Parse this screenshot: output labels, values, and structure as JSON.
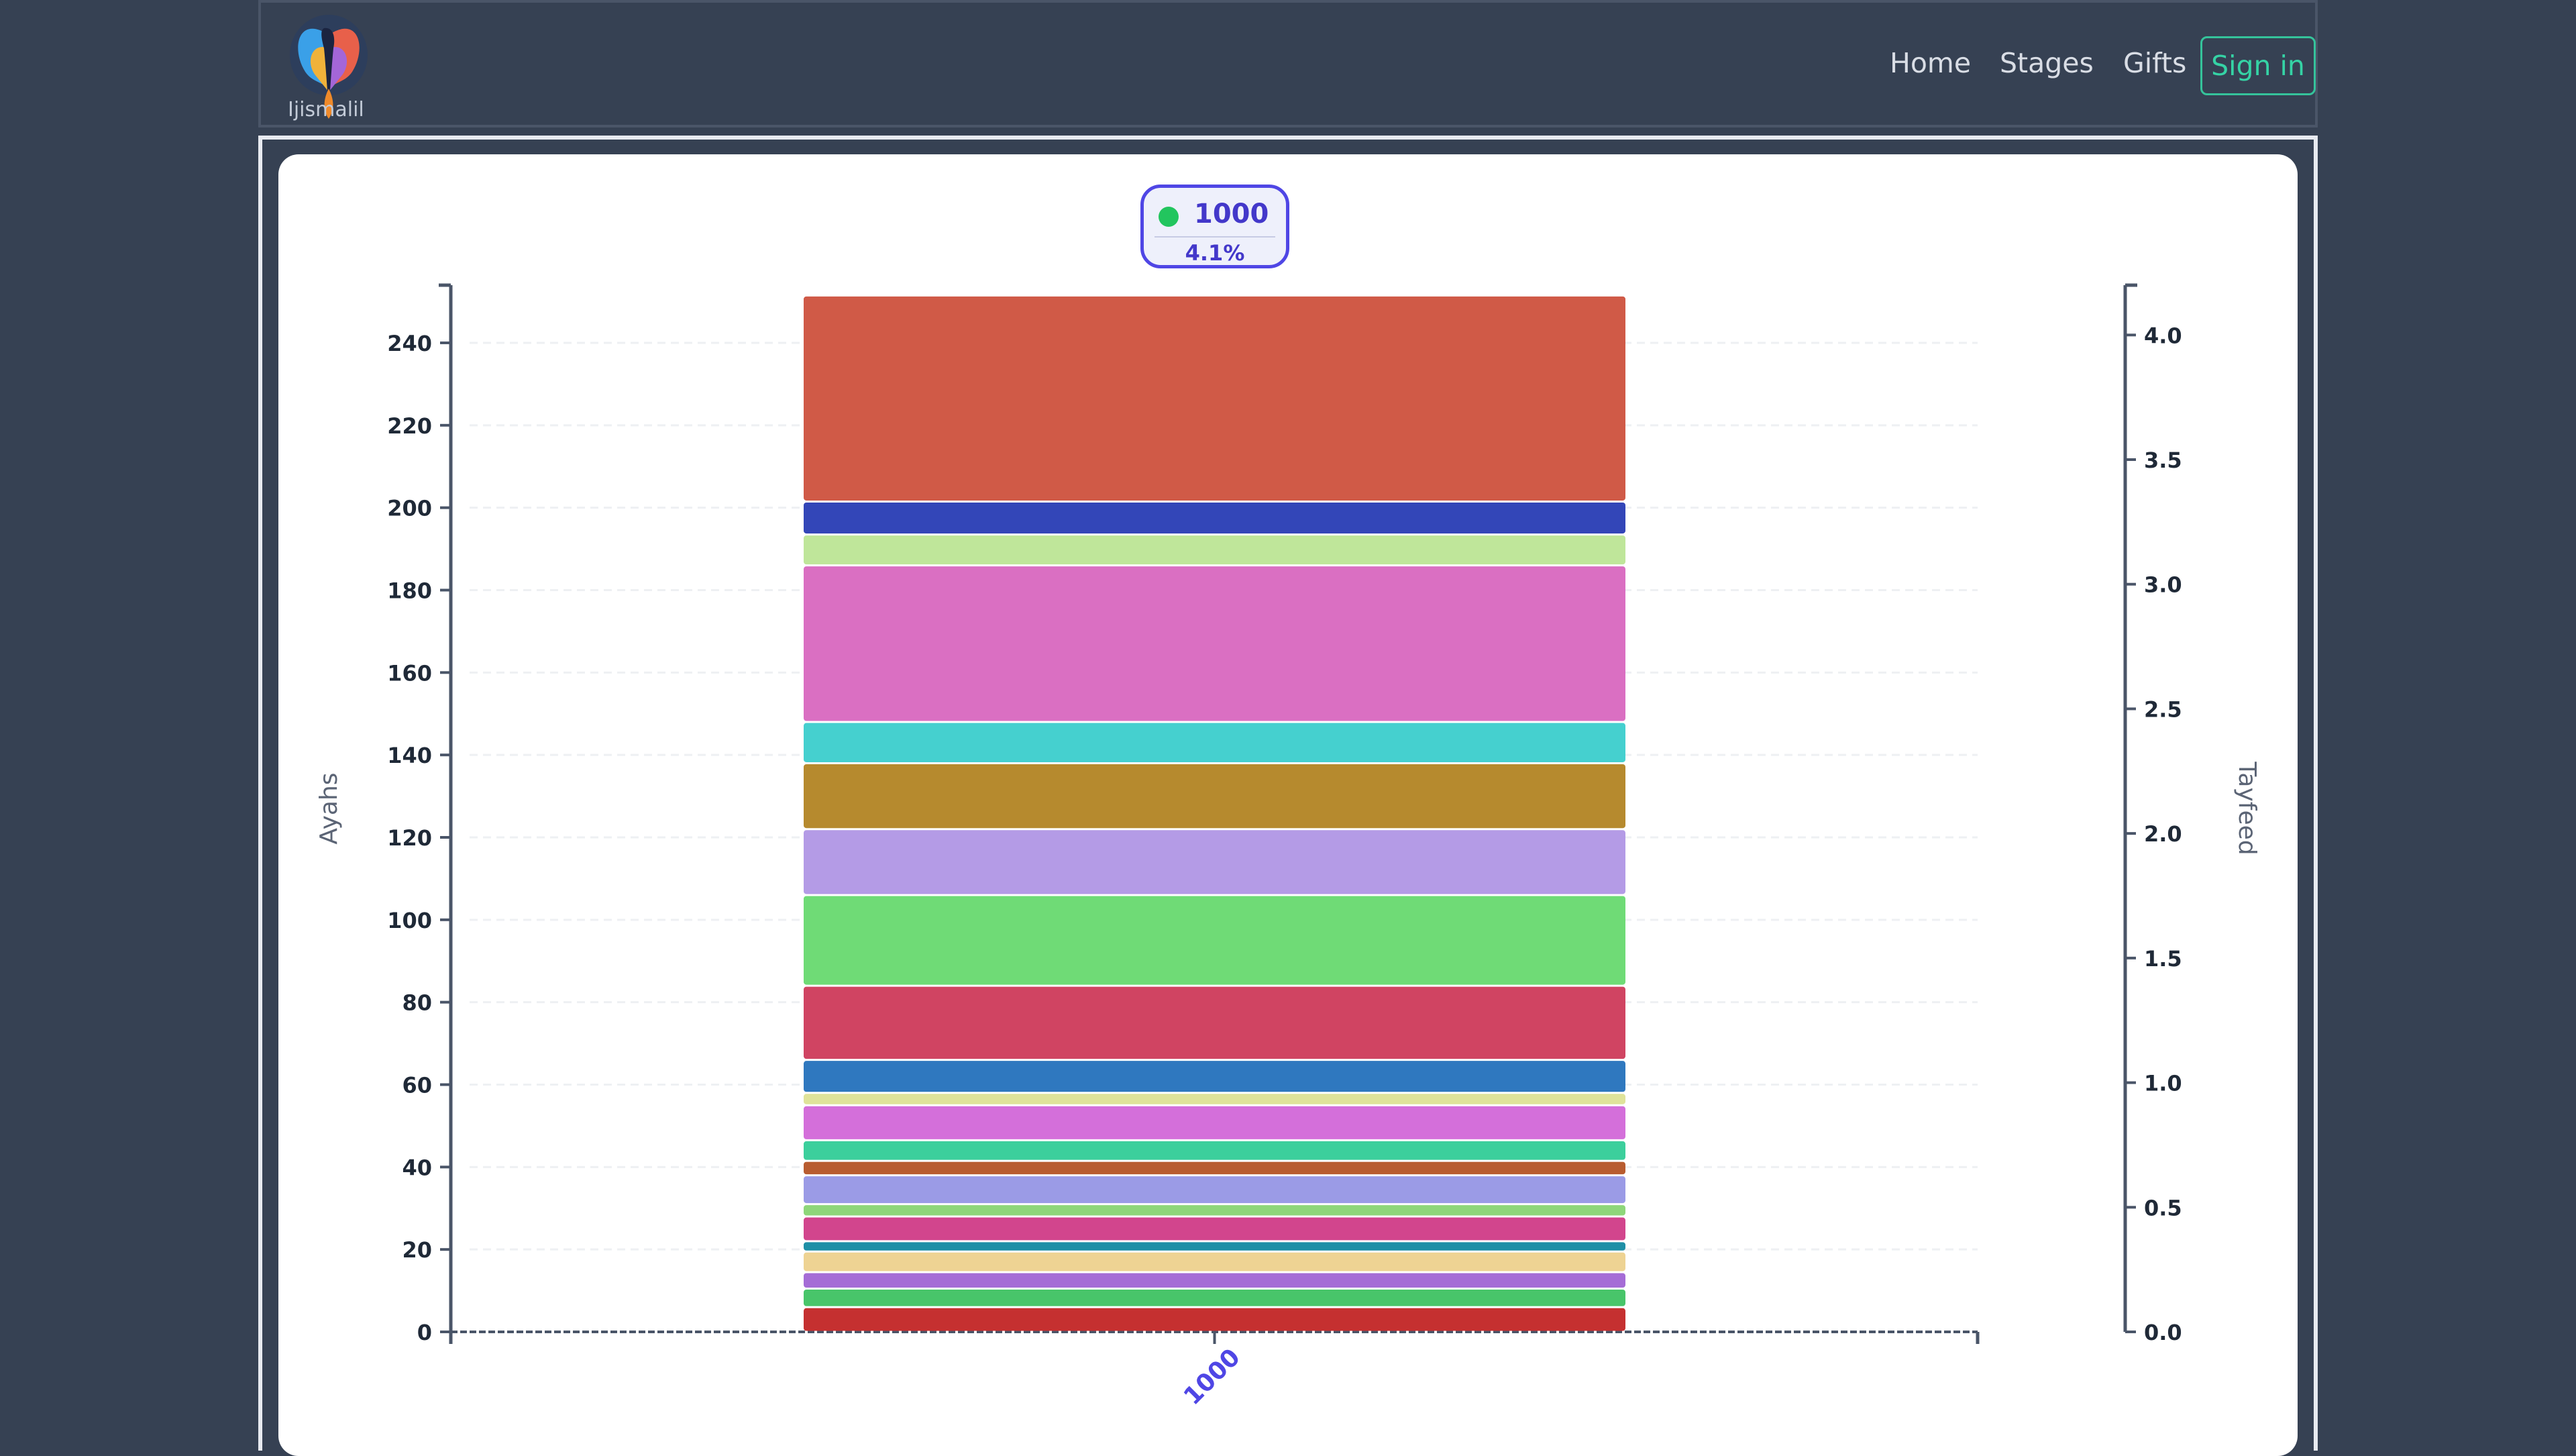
{
  "brand": {
    "logo_text": "Ijismalil"
  },
  "nav": {
    "home": "Home",
    "stages": "Stages",
    "gifts": "Gifts",
    "signin": "Sign in"
  },
  "tooltip": {
    "label": "1000",
    "value": "4.1%",
    "dot_color": "#22c55e"
  },
  "colors": {
    "accent": "#4f46e5",
    "signin": "#35c39b",
    "background": "#364153"
  },
  "chart_data": {
    "type": "bar",
    "stacked": true,
    "categories": [
      "1000"
    ],
    "xlabel": "",
    "ylabel": "Ayahs",
    "y2label": "Tayfeed",
    "ylim": [
      0,
      254
    ],
    "y2lim": [
      0,
      4.2
    ],
    "yticks": [
      0,
      20,
      40,
      60,
      80,
      100,
      120,
      140,
      160,
      180,
      200,
      220,
      240
    ],
    "y2ticks": [
      "0.0",
      "0.5",
      "1.0",
      "1.5",
      "2.0",
      "2.5",
      "3.0",
      "3.5",
      "4.0"
    ],
    "grid": true,
    "segments": [
      {
        "value": 6,
        "color": "#c53030"
      },
      {
        "value": 4.5,
        "color": "#48c56a"
      },
      {
        "value": 4,
        "color": "#a56cd6"
      },
      {
        "value": 5,
        "color": "#eed393"
      },
      {
        "value": 2.5,
        "color": "#1f8fa6"
      },
      {
        "value": 6,
        "color": "#d2458d"
      },
      {
        "value": 3,
        "color": "#8ed67a"
      },
      {
        "value": 7,
        "color": "#9b9be6"
      },
      {
        "value": 3.5,
        "color": "#b85c30"
      },
      {
        "value": 5,
        "color": "#3ccf9c"
      },
      {
        "value": 8.5,
        "color": "#d46fda"
      },
      {
        "value": 3,
        "color": "#dfe39a"
      },
      {
        "value": 8,
        "color": "#2f78bf"
      },
      {
        "value": 18,
        "color": "#d04462"
      },
      {
        "value": 22,
        "color": "#6fdb76"
      },
      {
        "value": 16,
        "color": "#b49be6"
      },
      {
        "value": 16,
        "color": "#b68a2e"
      },
      {
        "value": 10,
        "color": "#45d0cf"
      },
      {
        "value": 38,
        "color": "#da6fc2"
      },
      {
        "value": 7.5,
        "color": "#bfe69a"
      },
      {
        "value": 8,
        "color": "#3346b8"
      },
      {
        "value": 50,
        "color": "#d05a47"
      }
    ]
  }
}
